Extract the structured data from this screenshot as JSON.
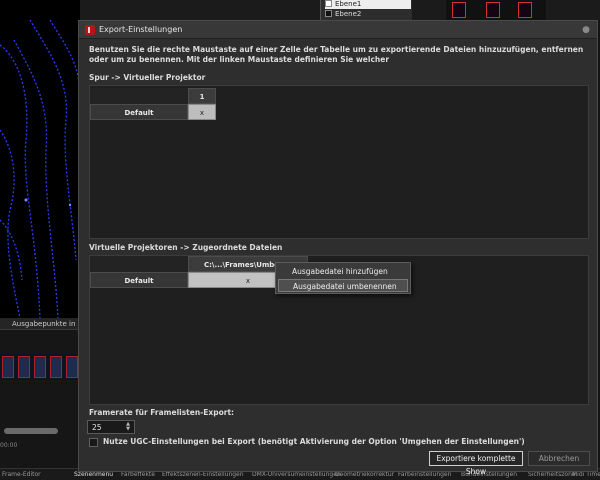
{
  "background": {
    "layers": [
      "Ebene1",
      "Ebene2"
    ],
    "side_tab": "Ausgabepunkte in",
    "timeline_time": "00:00",
    "bottom_tabs": [
      "Frame-Editor",
      "Szenenmenü",
      "Farbeffekte",
      "Effektszenen-Einstellungen",
      "DMX-Universumeinstellungen",
      "Geometriekorrektur",
      "Farbeinstellungen",
      "Bundeinstellungen",
      "Sicherheitszone",
      "Midi Time"
    ]
  },
  "dialog": {
    "title": "Export-Einstellungen",
    "info": "Benutzen Sie die rechte Maustaste auf einer Zelle der Tabelle um zu exportierende Dateien hinzuzufügen, entfernen oder um zu benennen. Mit der linken Maustaste definieren Sie welcher",
    "section1": {
      "label": "Spur -> Virtueller Projektor",
      "column": "1",
      "row": "Default",
      "cell": "x"
    },
    "section2": {
      "label": "Virtuelle Projektoren -> Zugeordnete Dateien",
      "column": "C:\\...\\Frames\\Umben...",
      "row": "Default",
      "cell": "x"
    },
    "context_menu": {
      "items": [
        "Ausgabedatei hinzufügen",
        "Ausgabedatei umbenennen"
      ],
      "highlighted_index": 1
    },
    "framerate_label": "Framerate für Framelisten-Export:",
    "framerate_value": "25",
    "ugc_checkbox_label": "Nutze UGC-Einstellungen bei Export (benötigt Aktivierung der Option 'Umgehen der Einstellungen')",
    "ugc_checked": false,
    "export_button": "Exportiere komplette Show",
    "cancel_button": "Abbrechen"
  },
  "colors": {
    "dialog_bg": "#2e2e2e",
    "panel_bg": "#1f1f1f",
    "cell_bg": "#bdbdbd",
    "accent_red": "#b01818",
    "laser_blue": "#2a3cff"
  }
}
